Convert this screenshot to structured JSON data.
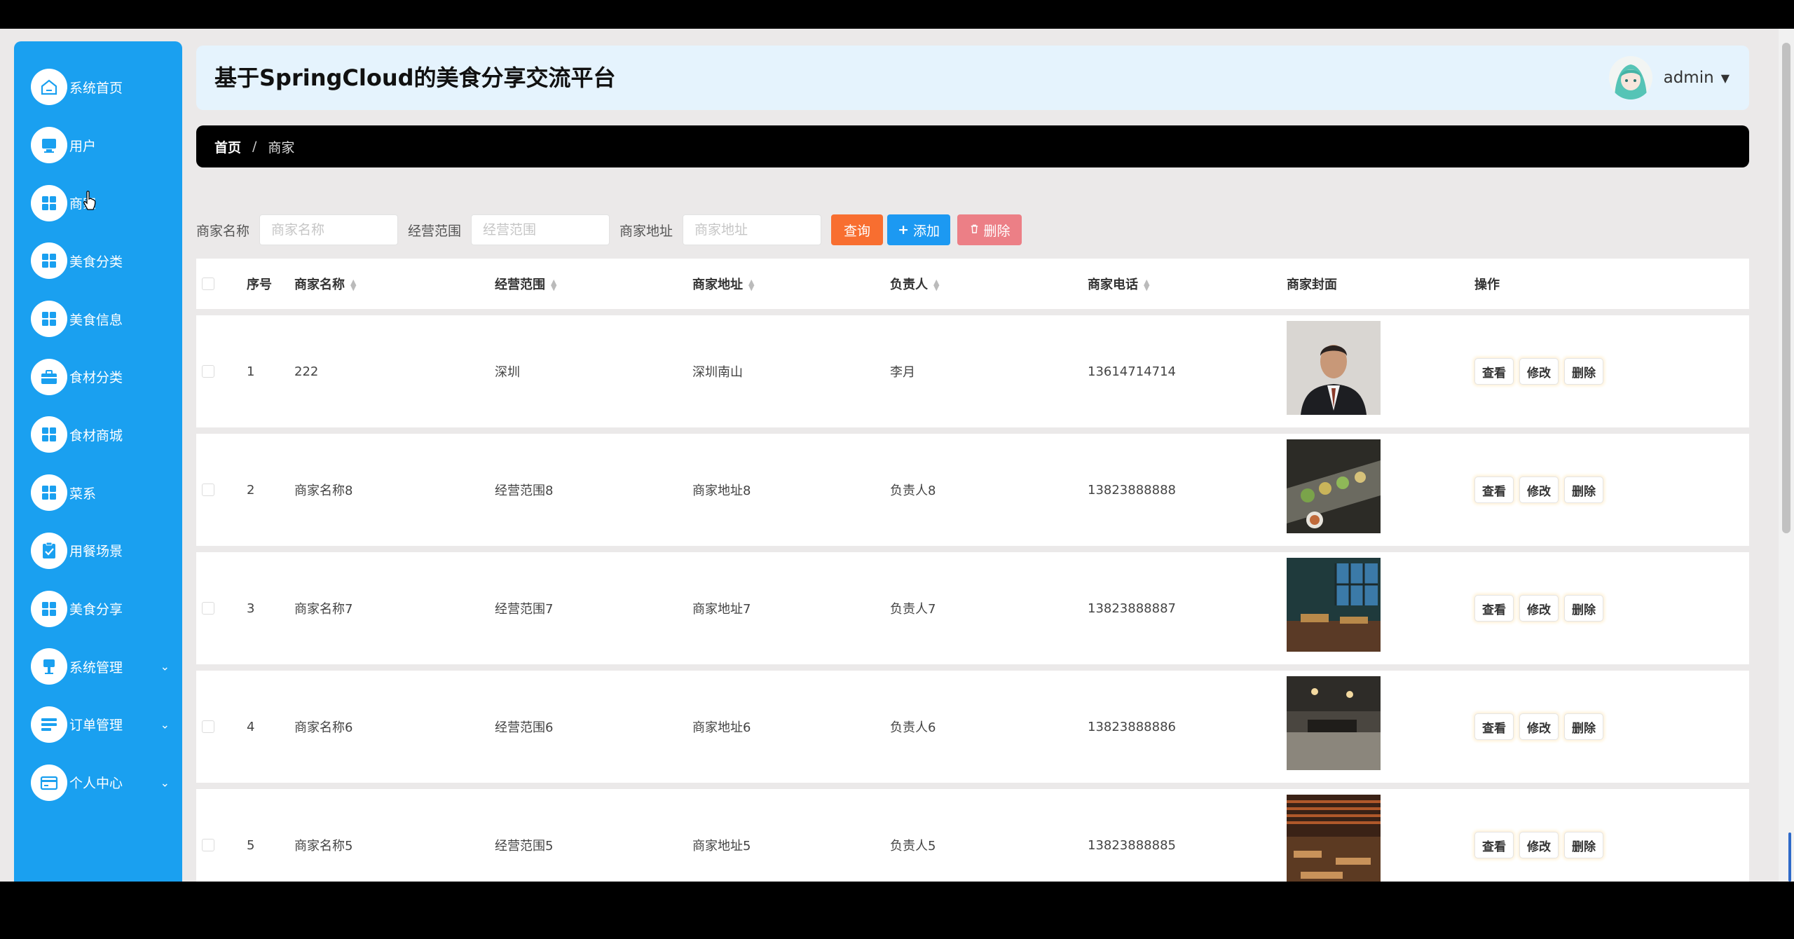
{
  "app_title": "基于SpringCloud的美食分享交流平台",
  "user": {
    "name": "admin"
  },
  "sidebar": {
    "items": [
      {
        "label": "系统首页",
        "icon": "home-icon"
      },
      {
        "label": "用户",
        "icon": "monitor-icon"
      },
      {
        "label": "商家",
        "icon": "grid-icon"
      },
      {
        "label": "美食分类",
        "icon": "grid-icon"
      },
      {
        "label": "美食信息",
        "icon": "grid-icon"
      },
      {
        "label": "食材分类",
        "icon": "briefcase-icon"
      },
      {
        "label": "食材商城",
        "icon": "grid-icon"
      },
      {
        "label": "菜系",
        "icon": "grid-icon"
      },
      {
        "label": "用餐场景",
        "icon": "clipboard-check-icon"
      },
      {
        "label": "美食分享",
        "icon": "grid-icon"
      },
      {
        "label": "系统管理",
        "icon": "pin-icon"
      },
      {
        "label": "订单管理",
        "icon": "list-icon"
      },
      {
        "label": "个人中心",
        "icon": "card-icon"
      }
    ]
  },
  "breadcrumb": {
    "home": "首页",
    "separator": "/",
    "current": "商家"
  },
  "search": {
    "name_label": "商家名称",
    "name_placeholder": "商家名称",
    "scope_label": "经营范围",
    "scope_placeholder": "经营范围",
    "addr_label": "商家地址",
    "addr_placeholder": "商家地址",
    "query_label": "查询",
    "add_label": "添加",
    "delete_label": "删除"
  },
  "table": {
    "headers": {
      "index": "序号",
      "name": "商家名称",
      "scope": "经营范围",
      "address": "商家地址",
      "owner": "负责人",
      "phone": "商家电话",
      "cover": "商家封面",
      "ops": "操作"
    },
    "op_labels": {
      "view": "查看",
      "edit": "修改",
      "delete": "删除"
    },
    "rows": [
      {
        "index": "1",
        "name": "222",
        "scope": "深圳",
        "address": "深圳南山",
        "owner": "李月",
        "phone": "13614714714"
      },
      {
        "index": "2",
        "name": "商家名称8",
        "scope": "经营范围8",
        "address": "商家地址8",
        "owner": "负责人8",
        "phone": "13823888888"
      },
      {
        "index": "3",
        "name": "商家名称7",
        "scope": "经营范围7",
        "address": "商家地址7",
        "owner": "负责人7",
        "phone": "13823888887"
      },
      {
        "index": "4",
        "name": "商家名称6",
        "scope": "经营范围6",
        "address": "商家地址6",
        "owner": "负责人6",
        "phone": "13823888886"
      },
      {
        "index": "5",
        "name": "商家名称5",
        "scope": "经营范围5",
        "address": "商家地址5",
        "owner": "负责人5",
        "phone": "13823888885"
      }
    ]
  },
  "colors": {
    "sidebar": "#1aa0f0",
    "header_bg": "#e5f3fd",
    "query_btn": "#f86e30",
    "add_btn": "#1c99f2",
    "delete_btn": "#ec7f86"
  }
}
